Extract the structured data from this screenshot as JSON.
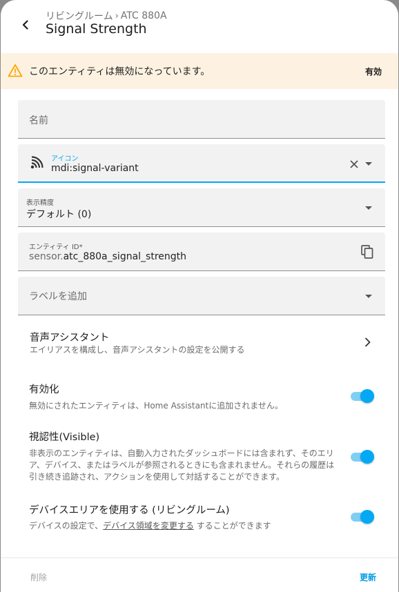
{
  "header": {
    "breadcrumb_area": "リビングルーム",
    "breadcrumb_device": "ATC 880A",
    "title": "Signal Strength"
  },
  "warning": {
    "text": "このエンティティは無効になっています。",
    "action_label": "有効",
    "color": "#fdf2e1",
    "icon_color": "#ffa600"
  },
  "fields": {
    "name": {
      "placeholder": "名前",
      "value": ""
    },
    "icon": {
      "label": "アイコン",
      "value": "mdi:signal-variant",
      "icon": "signal-variant-icon"
    },
    "precision": {
      "label": "表示精度",
      "value": "デフォルト (0)"
    },
    "entity_id": {
      "label": "エンティティ ID*",
      "prefix": "sensor.",
      "value": "atc_880a_signal_strength"
    },
    "labels": {
      "placeholder": "ラベルを追加"
    }
  },
  "voice_assistant": {
    "title": "音声アシスタント",
    "subtitle": "エイリアスを構成し、音声アシスタントの設定を公開する"
  },
  "settings": {
    "enabled": {
      "title": "有効化",
      "subtitle": "無効にされたエンティティは、Home Assistantに追加されません。",
      "on": true
    },
    "visible": {
      "title": "視認性(Visible)",
      "subtitle": "非表示のエンティティは、自動入力されたダッシュボードには含まれず、そのエリア、デバイス、またはラベルが参照されるときにも含まれません。それらの履歴は引き続き追跡され、アクションを使用して対話することができます。",
      "on": true
    },
    "device_area": {
      "title": "デバイスエリアを使用する (リビングルーム)",
      "subtitle_before": "デバイスの設定で、",
      "subtitle_link": "デバイス領域を変更する",
      "subtitle_after": " することができます",
      "on": true
    }
  },
  "footer": {
    "delete_label": "削除",
    "update_label": "更新"
  },
  "colors": {
    "accent": "#03a9f4",
    "toggle_track": "#7fcff5"
  }
}
